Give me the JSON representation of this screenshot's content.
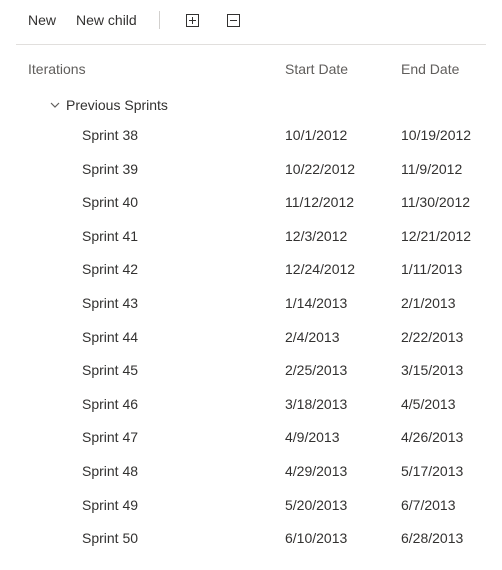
{
  "toolbar": {
    "new_label": "New",
    "new_child_label": "New child"
  },
  "columns": {
    "iterations": "Iterations",
    "start_date": "Start Date",
    "end_date": "End Date"
  },
  "group": {
    "label": "Previous Sprints"
  },
  "rows": [
    {
      "name": "Sprint 38",
      "start": "10/1/2012",
      "end": "10/19/2012"
    },
    {
      "name": "Sprint 39",
      "start": "10/22/2012",
      "end": "11/9/2012"
    },
    {
      "name": "Sprint 40",
      "start": "11/12/2012",
      "end": "11/30/2012"
    },
    {
      "name": "Sprint 41",
      "start": "12/3/2012",
      "end": "12/21/2012"
    },
    {
      "name": "Sprint 42",
      "start": "12/24/2012",
      "end": "1/11/2013"
    },
    {
      "name": "Sprint 43",
      "start": "1/14/2013",
      "end": "2/1/2013"
    },
    {
      "name": "Sprint 44",
      "start": "2/4/2013",
      "end": "2/22/2013"
    },
    {
      "name": "Sprint 45",
      "start": "2/25/2013",
      "end": "3/15/2013"
    },
    {
      "name": "Sprint 46",
      "start": "3/18/2013",
      "end": "4/5/2013"
    },
    {
      "name": "Sprint 47",
      "start": "4/9/2013",
      "end": "4/26/2013"
    },
    {
      "name": "Sprint 48",
      "start": "4/29/2013",
      "end": "5/17/2013"
    },
    {
      "name": "Sprint 49",
      "start": "5/20/2013",
      "end": "6/7/2013"
    },
    {
      "name": "Sprint 50",
      "start": "6/10/2013",
      "end": "6/28/2013"
    }
  ]
}
